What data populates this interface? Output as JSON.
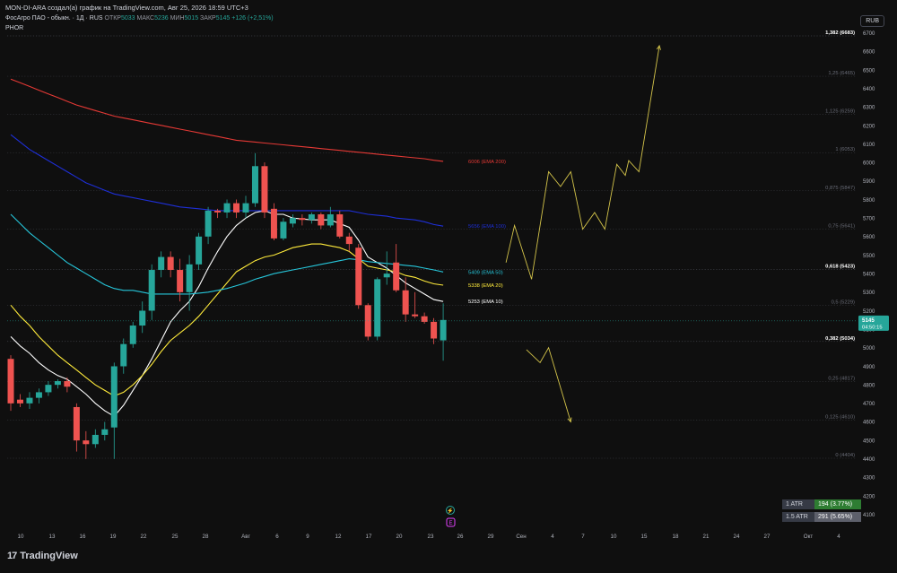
{
  "header": {
    "publisher_line": "MON-DI-ARA создал(а) график на TradingView.com, Авг 25, 2026 18:59 UTC+3",
    "symbol": "ФосАгро ПАО - обыкн. · 1Д · RUS",
    "open_label": "ОТКР",
    "open_value": "5033",
    "high_label": "МАКС",
    "high_value": "5236",
    "low_label": "МИН",
    "low_value": "5015",
    "close_label": "ЗАКР",
    "close_value": "5145",
    "change": "+126 (+2,51%)",
    "ticker": "PHOR",
    "currency": "RUB"
  },
  "brand": {
    "logo_mark": "17",
    "name": "TradingView"
  },
  "atr": [
    {
      "label": "1 ATR",
      "value": "194 (3.77%)"
    },
    {
      "label": "1.5 ATR",
      "value": "291 (5.65%)"
    }
  ],
  "colors": {
    "up": "#26a69a",
    "down": "#ef5350",
    "ema10": "#ffffff",
    "ema20": "#ffeb3b",
    "ema50": "#26c6da",
    "ema100": "#1e2fd8",
    "ema200": "#e53935",
    "projection": "#d4c44a",
    "fib_line": "#5d606b"
  },
  "chart_data": {
    "type": "candlestick",
    "y_axis": {
      "min": 4100,
      "max": 6700,
      "ticks": [
        4100,
        4200,
        4300,
        4400,
        4500,
        4600,
        4700,
        4800,
        4900,
        5000,
        5100,
        5200,
        5300,
        5400,
        5500,
        5600,
        5700,
        5800,
        5900,
        6000,
        6100,
        6200,
        6300,
        6400,
        6500,
        6600,
        6700
      ]
    },
    "x_axis": {
      "ticks": [
        "10",
        "13",
        "16",
        "19",
        "22",
        "25",
        "28",
        "Авг",
        "6",
        "9",
        "12",
        "17",
        "20",
        "23",
        "26",
        "29",
        "Сен",
        "4",
        "7",
        "10",
        "15",
        "18",
        "21",
        "24",
        "27",
        "Окт",
        "4"
      ]
    },
    "candles": [
      [
        4940,
        4960,
        4660,
        4700
      ],
      [
        4720,
        4750,
        4680,
        4700
      ],
      [
        4700,
        4760,
        4670,
        4730
      ],
      [
        4730,
        4780,
        4700,
        4760
      ],
      [
        4760,
        4820,
        4740,
        4800
      ],
      [
        4800,
        4830,
        4780,
        4820
      ],
      [
        4820,
        4840,
        4760,
        4790
      ],
      [
        4680,
        4700,
        4440,
        4500
      ],
      [
        4500,
        4550,
        4400,
        4480
      ],
      [
        4480,
        4560,
        4460,
        4530
      ],
      [
        4530,
        4600,
        4500,
        4560
      ],
      [
        4570,
        4920,
        4400,
        4900
      ],
      [
        4900,
        5050,
        4860,
        5020
      ],
      [
        5020,
        5140,
        5000,
        5120
      ],
      [
        5120,
        5250,
        5080,
        5200
      ],
      [
        5200,
        5450,
        5150,
        5420
      ],
      [
        5420,
        5520,
        5380,
        5490
      ],
      [
        5490,
        5520,
        5380,
        5420
      ],
      [
        5420,
        5480,
        5250,
        5300
      ],
      [
        5300,
        5500,
        5200,
        5450
      ],
      [
        5450,
        5620,
        5420,
        5600
      ],
      [
        5600,
        5760,
        5560,
        5740
      ],
      [
        5740,
        5750,
        5700,
        5730
      ],
      [
        5730,
        5800,
        5700,
        5780
      ],
      [
        5780,
        5800,
        5700,
        5730
      ],
      [
        5730,
        5820,
        5700,
        5780
      ],
      [
        5780,
        6050,
        5760,
        5980
      ],
      [
        5980,
        6000,
        5700,
        5730
      ],
      [
        5750,
        5780,
        5580,
        5590
      ],
      [
        5590,
        5700,
        5580,
        5680
      ],
      [
        5670,
        5720,
        5650,
        5700
      ],
      [
        5700,
        5720,
        5660,
        5690
      ],
      [
        5690,
        5730,
        5670,
        5720
      ],
      [
        5720,
        5730,
        5640,
        5660
      ],
      [
        5660,
        5760,
        5650,
        5720
      ],
      [
        5720,
        5740,
        5590,
        5600
      ],
      [
        5600,
        5620,
        5520,
        5560
      ],
      [
        5540,
        5560,
        5210,
        5230
      ],
      [
        5230,
        5240,
        5040,
        5060
      ],
      [
        5060,
        5380,
        5040,
        5370
      ],
      [
        5380,
        5520,
        5340,
        5400
      ],
      [
        5460,
        5560,
        5300,
        5310
      ],
      [
        5310,
        5380,
        5140,
        5180
      ],
      [
        5180,
        5300,
        5160,
        5170
      ],
      [
        5170,
        5190,
        5130,
        5140
      ],
      [
        5140,
        5160,
        5020,
        5050
      ],
      [
        5040,
        5240,
        4930,
        5150
      ]
    ],
    "series": [
      {
        "name": "EMA 10",
        "last_label": "5253 (EMA 10)",
        "color": "#ffffff",
        "values": [
          5060,
          5010,
          4970,
          4920,
          4880,
          4850,
          4830,
          4790,
          4750,
          4700,
          4660,
          4630,
          4690,
          4770,
          4850,
          4940,
          5040,
          5140,
          5200,
          5250,
          5330,
          5430,
          5520,
          5600,
          5660,
          5700,
          5730,
          5740,
          5720,
          5720,
          5700,
          5695,
          5690,
          5690,
          5690,
          5670,
          5650,
          5580,
          5490,
          5460,
          5430,
          5390,
          5350,
          5320,
          5290,
          5260,
          5250
        ]
      },
      {
        "name": "EMA 20",
        "last_label": "5338 (EMA 20)",
        "color": "#ffeb3b",
        "values": [
          5230,
          5170,
          5120,
          5060,
          5010,
          4960,
          4920,
          4880,
          4840,
          4800,
          4770,
          4740,
          4760,
          4800,
          4850,
          4910,
          4980,
          5040,
          5080,
          5120,
          5170,
          5230,
          5290,
          5350,
          5410,
          5440,
          5470,
          5490,
          5500,
          5520,
          5540,
          5550,
          5560,
          5560,
          5550,
          5540,
          5520,
          5480,
          5440,
          5430,
          5420,
          5410,
          5390,
          5380,
          5360,
          5345,
          5338
        ]
      },
      {
        "name": "EMA 50",
        "last_label": "5409 (EMA 50)",
        "color": "#26c6da",
        "values": [
          5720,
          5670,
          5620,
          5580,
          5540,
          5500,
          5460,
          5430,
          5400,
          5370,
          5340,
          5320,
          5310,
          5310,
          5300,
          5290,
          5290,
          5290,
          5290,
          5290,
          5295,
          5300,
          5310,
          5320,
          5335,
          5350,
          5370,
          5385,
          5400,
          5410,
          5420,
          5430,
          5440,
          5450,
          5460,
          5470,
          5480,
          5475,
          5465,
          5460,
          5455,
          5450,
          5445,
          5440,
          5430,
          5420,
          5409
        ]
      },
      {
        "name": "EMA 100",
        "last_label": "5656 (EMA 100)",
        "color": "#1e2fd8",
        "values": [
          6150,
          6110,
          6070,
          6040,
          6010,
          5980,
          5950,
          5920,
          5890,
          5870,
          5850,
          5830,
          5820,
          5810,
          5800,
          5790,
          5780,
          5770,
          5760,
          5755,
          5750,
          5745,
          5740,
          5740,
          5740,
          5740,
          5740,
          5740,
          5740,
          5740,
          5740,
          5740,
          5740,
          5740,
          5740,
          5740,
          5740,
          5730,
          5720,
          5715,
          5710,
          5700,
          5695,
          5690,
          5680,
          5665,
          5656
        ]
      },
      {
        "name": "EMA 200",
        "last_label": "6006 (EMA 200)",
        "color": "#e53935",
        "values": [
          6450,
          6430,
          6410,
          6390,
          6370,
          6350,
          6330,
          6310,
          6295,
          6280,
          6265,
          6250,
          6240,
          6230,
          6220,
          6210,
          6200,
          6190,
          6180,
          6170,
          6160,
          6150,
          6140,
          6130,
          6120,
          6115,
          6110,
          6105,
          6100,
          6095,
          6090,
          6085,
          6080,
          6075,
          6070,
          6065,
          6060,
          6055,
          6050,
          6045,
          6040,
          6035,
          6030,
          6025,
          6020,
          6012,
          6006
        ]
      }
    ],
    "fib_levels": [
      {
        "label": "0 (4404)",
        "value": 4404
      },
      {
        "label": "0,125 (4610)",
        "value": 4610
      },
      {
        "label": "0,25 (4817)",
        "value": 4817
      },
      {
        "label": "0,382 (5034)",
        "value": 5034,
        "bold": true
      },
      {
        "label": "0,5 (5229)",
        "value": 5229
      },
      {
        "label": "0,618 (5423)",
        "value": 5423,
        "bold": true
      },
      {
        "label": "0,75 (5641)",
        "value": 5641
      },
      {
        "label": "0,875 (5847)",
        "value": 5847
      },
      {
        "label": "1 (6053)",
        "value": 6053
      },
      {
        "label": "1,125 (6259)",
        "value": 6259
      },
      {
        "label": "1,25 (6465)",
        "value": 6465
      },
      {
        "label": "1,382 (6683)",
        "value": 6683,
        "bold": true
      }
    ],
    "last_price": {
      "value": 5145,
      "label": "5145",
      "countdown": "04:50:15"
    },
    "projection_up": [
      [
        0,
        5460
      ],
      [
        0.5,
        5660
      ],
      [
        1.5,
        5370
      ],
      [
        2.5,
        5950
      ],
      [
        3.2,
        5870
      ],
      [
        3.8,
        5950
      ],
      [
        4.5,
        5640
      ],
      [
        5.2,
        5730
      ],
      [
        5.8,
        5640
      ],
      [
        6.5,
        5990
      ],
      [
        7.0,
        5930
      ],
      [
        7.2,
        6010
      ],
      [
        7.8,
        5950
      ],
      [
        9.0,
        6630
      ]
    ],
    "projection_down": [
      [
        1.2,
        4990
      ],
      [
        2.0,
        4920
      ],
      [
        2.5,
        5000
      ],
      [
        3.8,
        4600
      ]
    ]
  }
}
